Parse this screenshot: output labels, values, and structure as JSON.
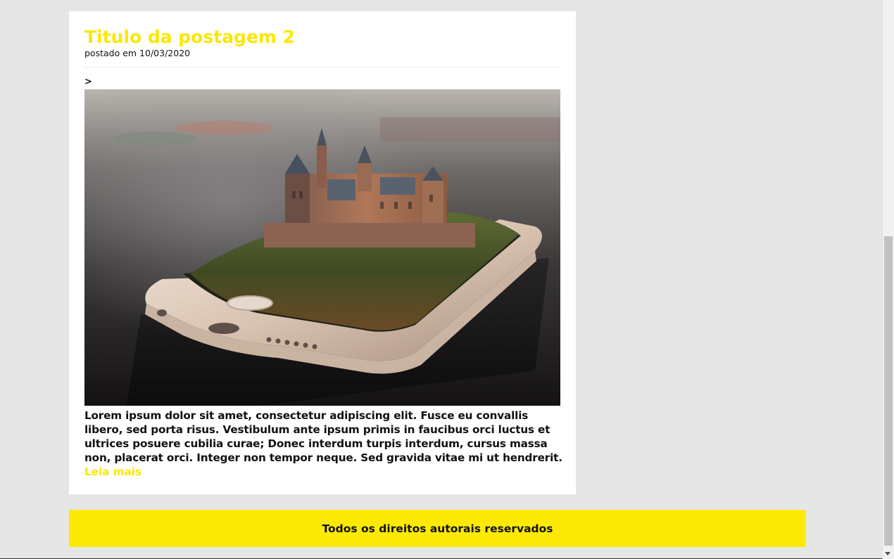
{
  "post": {
    "title": "Titulo da postagem 2",
    "date": "postado em 10/03/2020",
    "stray_char": ">",
    "image_label": "castle-on-smartphone-image",
    "excerpt": "Lorem ipsum dolor sit amet, consectetur adipiscing elit. Fusce eu convallis libero, sed porta risus. Vestibulum ante ipsum primis in faucibus orci luctus et ultrices posuere cubilia curae; Donec interdum turpis interdum, cursus massa non, placerat orci. Integer non tempor neque. Sed gravida vitae mi ut hendrerit.",
    "read_more": "Leia mais"
  },
  "footer": {
    "text": "Todos os direitos autorais reservados"
  },
  "colors": {
    "accent": "#fce703",
    "page_background": "#e6e6e6",
    "card_background": "#ffffff",
    "footer_background": "#fcea04",
    "text": "#111111"
  }
}
